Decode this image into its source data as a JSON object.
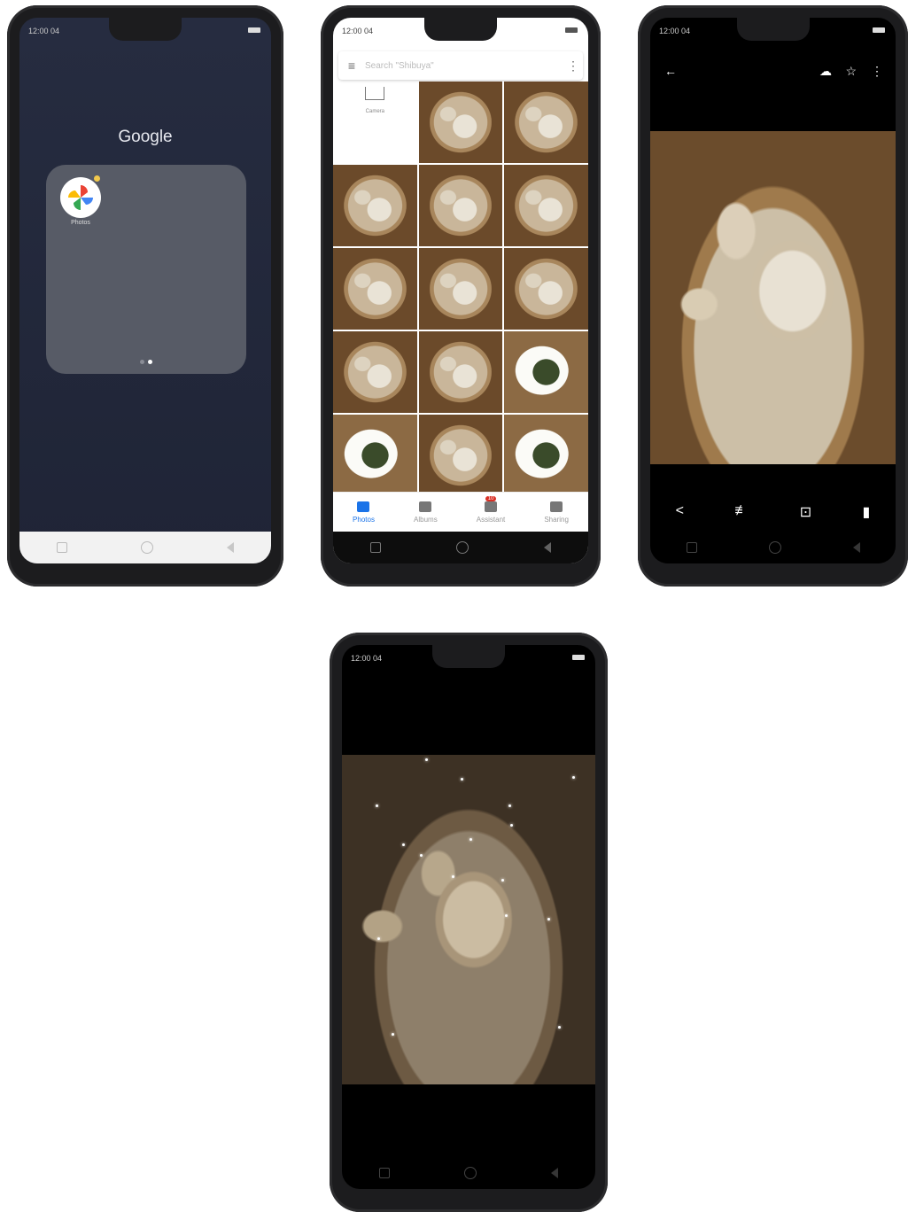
{
  "status_bar": {
    "time": "12:00 04"
  },
  "phone1": {
    "folder_title": "Google",
    "app": {
      "label": "Photos",
      "icon": "google-photos-pinwheel-icon"
    }
  },
  "phone2": {
    "search_placeholder": "Search \"Shibuya\"",
    "camera_label": "Camera",
    "tabs": [
      {
        "label": "Photos",
        "active": true
      },
      {
        "label": "Albums",
        "active": false
      },
      {
        "label": "Assistant",
        "active": false,
        "badge": "10"
      },
      {
        "label": "Sharing",
        "active": false
      }
    ]
  },
  "phone3": {
    "toolbar_icons": [
      "back-arrow-icon",
      "cloud-upload-icon",
      "star-icon",
      "more-vert-icon"
    ],
    "action_icons": [
      "share-icon",
      "edit-sliders-icon",
      "lens-icon",
      "delete-icon"
    ]
  },
  "colors": {
    "accent_blue": "#1a73e8",
    "badge_red": "#d93025",
    "folder_bg": "#575b66"
  }
}
